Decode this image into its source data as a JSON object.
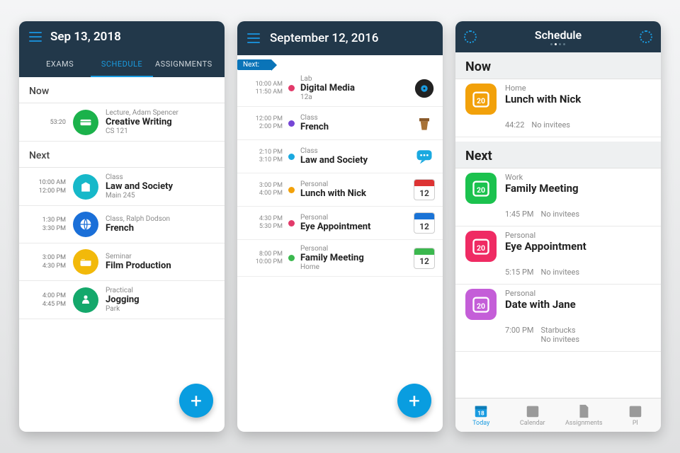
{
  "phone1": {
    "date": "Sep 13, 2018",
    "tabs": [
      "EXAMS",
      "SCHEDULE",
      "ASSIGNMENTS"
    ],
    "now_label": "Now",
    "next_label": "Next",
    "now_item": {
      "time": "53:20",
      "category": "Lecture, Adam Spencer",
      "title": "Creative Writing",
      "location": "CS 121",
      "color": "#1bb24b"
    },
    "next_items": [
      {
        "t1": "10:00 AM",
        "t2": "12:00 PM",
        "category": "Class",
        "title": "Law and Society",
        "location": "Main 245",
        "color": "#16b8c9"
      },
      {
        "t1": "1:30 PM",
        "t2": "3:30 PM",
        "category": "Class, Ralph Dodson",
        "title": "French",
        "location": "",
        "color": "#1a6fd8"
      },
      {
        "t1": "3:00 PM",
        "t2": "4:30 PM",
        "category": "Seminar",
        "title": "Film Production",
        "location": "",
        "color": "#f2b90a"
      },
      {
        "t1": "4:00 PM",
        "t2": "4:45 PM",
        "category": "Practical",
        "title": "Jogging",
        "location": "Park",
        "color": "#14a86b"
      }
    ]
  },
  "phone2": {
    "date": "September 12, 2016",
    "next_banner": "Next:",
    "items": [
      {
        "t1": "10:00 AM",
        "t2": "11:50 AM",
        "dot": "#e23a6a",
        "category": "Lab",
        "title": "Digital Media",
        "location": "12a",
        "icon": "vinyl"
      },
      {
        "t1": "12:00 PM",
        "t2": "2:00 PM",
        "dot": "#7646d6",
        "category": "Class",
        "title": "French",
        "location": "",
        "icon": "podium"
      },
      {
        "t1": "2:10 PM",
        "t2": "3:10 PM",
        "dot": "#1aa9e0",
        "category": "Class",
        "title": "Law and Society",
        "location": "",
        "icon": "chat"
      },
      {
        "t1": "3:00 PM",
        "t2": "4:00 PM",
        "dot": "#f2a10a",
        "category": "Personal",
        "title": "Lunch with Nick",
        "location": "",
        "icon": "cal",
        "calcolor": "#d33"
      },
      {
        "t1": "4:30 PM",
        "t2": "5:30 PM",
        "dot": "#e23a6a",
        "category": "Personal",
        "title": "Eye Appointment",
        "location": "",
        "icon": "cal",
        "calcolor": "#1a73d6"
      },
      {
        "t1": "8:00 PM",
        "t2": "10:00 PM",
        "dot": "#3bb84e",
        "category": "Personal",
        "title": "Family Meeting",
        "location": "Home",
        "icon": "cal",
        "calcolor": "#3bb84e"
      }
    ],
    "cal_num": "12"
  },
  "phone3": {
    "header": "Schedule",
    "now_label": "Now",
    "next_label": "Next",
    "now_item": {
      "category": "Home",
      "title": "Lunch with Nick",
      "time": "44:22",
      "invitees": "No invitees",
      "color": "#f2a10a"
    },
    "next_items": [
      {
        "category": "Work",
        "title": "Family Meeting",
        "time": "1:45 PM",
        "invitees": "No invitees",
        "color": "#1bc24e",
        "extra": ""
      },
      {
        "category": "Personal",
        "title": "Eye Appointment",
        "time": "5:15 PM",
        "invitees": "No invitees",
        "color": "#ef2b63",
        "extra": ""
      },
      {
        "category": "Personal",
        "title": "Date with Jane",
        "time": "7:00 PM",
        "invitees": "No invitees",
        "color": "#c45ed8",
        "extra": "Starbucks"
      }
    ],
    "cal_day": "20",
    "tabs": [
      {
        "label": "Today",
        "active": true
      },
      {
        "label": "Calendar",
        "active": false
      },
      {
        "label": "Assignments",
        "active": false
      },
      {
        "label": "Pl",
        "active": false
      }
    ]
  }
}
